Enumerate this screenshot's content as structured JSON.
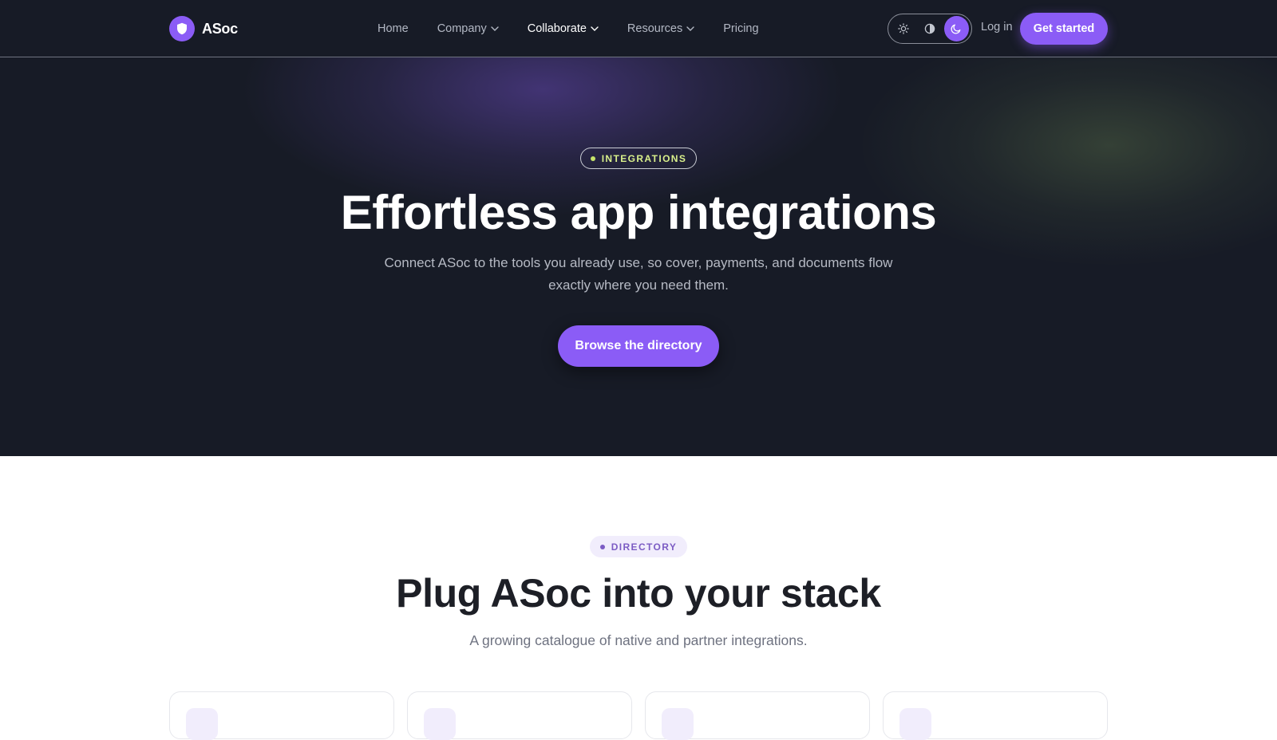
{
  "brand": {
    "name": "ASoc",
    "logo_icon": "shield-icon",
    "accent": "#8b5cf6"
  },
  "nav": {
    "links": [
      {
        "label": "Home",
        "has_dropdown": false
      },
      {
        "label": "Company",
        "has_dropdown": true
      },
      {
        "label": "Collaborate",
        "has_dropdown": true,
        "active": true
      },
      {
        "label": "Resources",
        "has_dropdown": true
      },
      {
        "label": "Pricing",
        "has_dropdown": false
      }
    ],
    "theme_options": [
      {
        "icon": "sun-icon",
        "selected": false
      },
      {
        "icon": "contrast-icon",
        "selected": false
      },
      {
        "icon": "moon-icon",
        "selected": true
      }
    ],
    "login_label": "Log in",
    "cta_label": "Get started"
  },
  "hero": {
    "badge": "INTEGRATIONS",
    "title": "Effortless app integrations",
    "subtitle": "Connect ASoc to the tools you already use, so cover, payments, and documents flow exactly where you need them.",
    "cta_label": "Browse the directory",
    "background": "#171b26"
  },
  "directory": {
    "badge": "DIRECTORY",
    "title": "Plug ASoc into your stack",
    "subtitle": "A growing catalogue of native and partner integrations."
  }
}
